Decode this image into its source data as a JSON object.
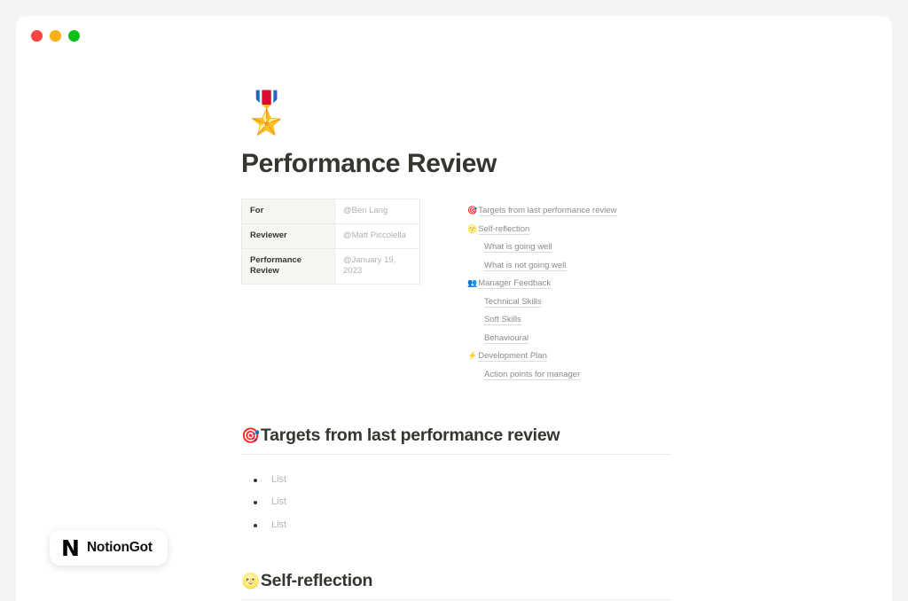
{
  "window": {
    "traffic_lights": [
      {
        "name": "close",
        "color": "#f9453f"
      },
      {
        "name": "minimize",
        "color": "#fbb116"
      },
      {
        "name": "maximize",
        "color": "#0ec01b"
      }
    ]
  },
  "document": {
    "page_icon": "🎖️",
    "title": "Performance Review",
    "properties": [
      {
        "key": "For",
        "value": "@Ben Lang"
      },
      {
        "key": "Reviewer",
        "value": "@Matt Piccolella"
      },
      {
        "key": "Performance Review",
        "value": "@January 19, 2023"
      }
    ],
    "table_of_contents": [
      {
        "emoji": "🎯",
        "label": "Targets from last performance review",
        "level": 1
      },
      {
        "emoji": "🌝",
        "label": "Self-reflection",
        "level": 1
      },
      {
        "emoji": "",
        "label": "What is going well",
        "level": 2
      },
      {
        "emoji": "",
        "label": "What is not going well",
        "level": 2
      },
      {
        "emoji": "👥",
        "label": "Manager Feedback",
        "level": 1
      },
      {
        "emoji": "",
        "label": "Technical Skills",
        "level": 2
      },
      {
        "emoji": "",
        "label": "Soft Skills",
        "level": 2
      },
      {
        "emoji": "",
        "label": "Behavioural",
        "level": 2
      },
      {
        "emoji": "⚡",
        "label": "Development Plan",
        "level": 1
      },
      {
        "emoji": "",
        "label": "Action points for manager",
        "level": 2
      }
    ],
    "sections": [
      {
        "emoji": "🎯",
        "heading": "Targets from last performance review",
        "bullets": [
          "List",
          "List",
          "List"
        ]
      },
      {
        "emoji": "🌝",
        "heading": "Self-reflection",
        "bullets": []
      }
    ]
  },
  "watermark": {
    "logo_glyph": "N",
    "label": "NotionGot"
  }
}
